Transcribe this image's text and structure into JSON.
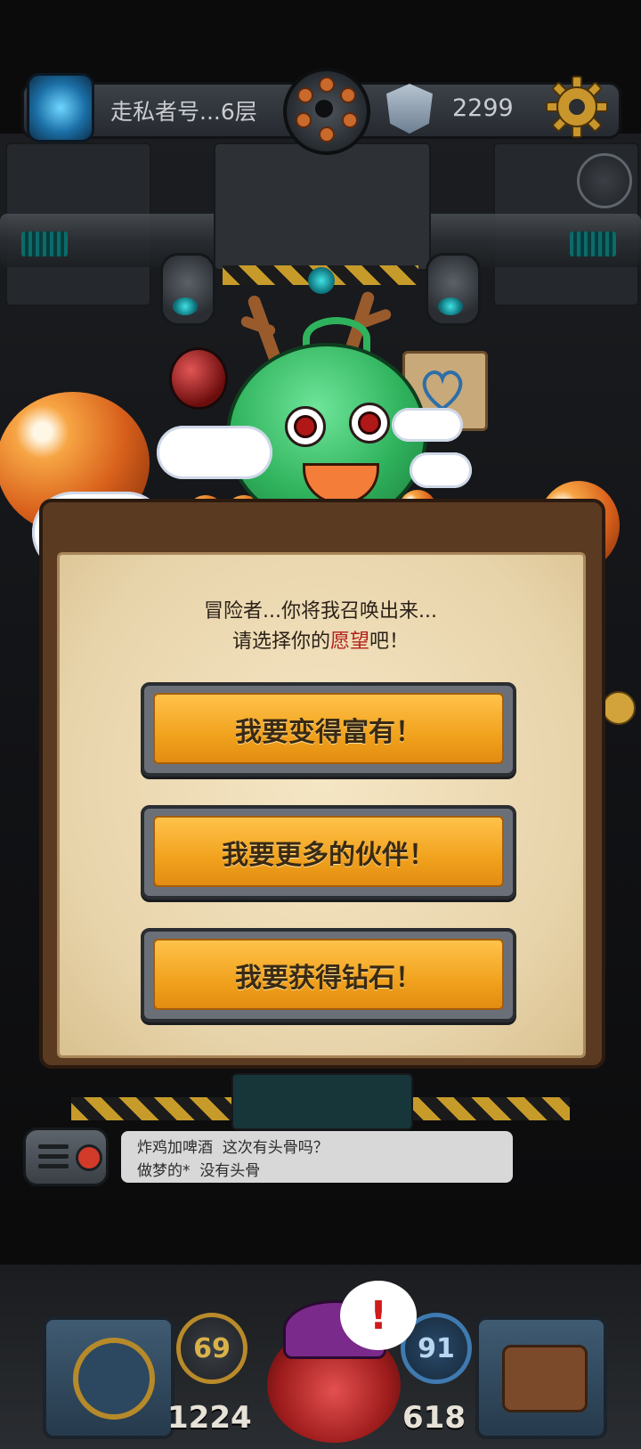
{
  "topbar": {
    "location": "走私者号...6层",
    "currency": "2299"
  },
  "dialog": {
    "line1": "冒险者...你将我召唤出来...",
    "line2_pre": "请选择你的",
    "line2_highlight": "愿望",
    "line2_post": "吧！",
    "options": [
      {
        "label": "我要变得富有！"
      },
      {
        "label": "我要更多的伙伴！"
      },
      {
        "label": "我要获得钻石！"
      }
    ]
  },
  "chat": {
    "line1_user": "炸鸡加啤酒",
    "line1_msg": "这次有头骨吗？",
    "line2_user": "做梦的*",
    "line2_msg": "没有头骨"
  },
  "hud": {
    "attack": "69",
    "defense": "91",
    "hp": "1224",
    "mp": "618",
    "alert": "!"
  },
  "colors": {
    "button_gold": "#f1a21d",
    "highlight_red": "#b3201b",
    "parchment": "#ecdcb6"
  }
}
